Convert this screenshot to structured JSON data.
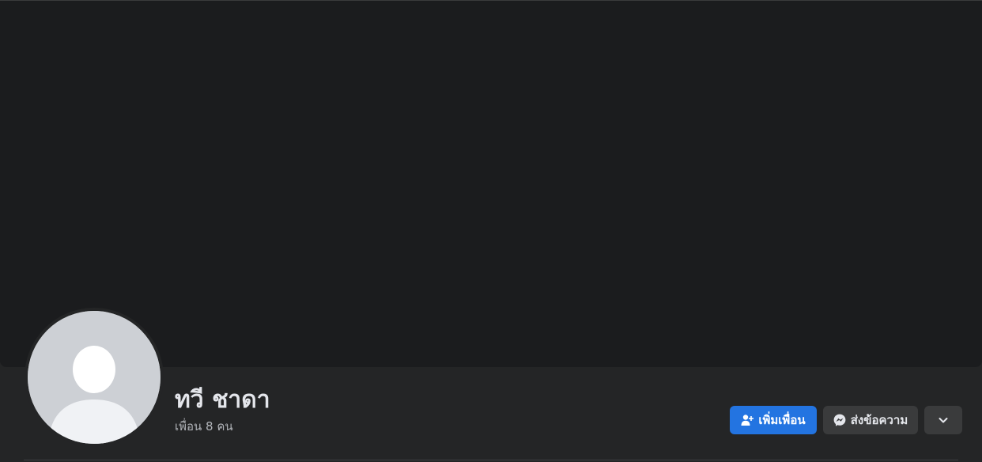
{
  "profile": {
    "name": "ทวี ชาดา",
    "friends_count_text": "เพื่อน 8 คน"
  },
  "actions": {
    "add_friend_label": "เพิ่มเพื่อน",
    "message_label": "ส่งข้อความ"
  },
  "icons": {
    "add_friend": "person-plus-icon",
    "message": "messenger-icon",
    "more": "chevron-down-icon",
    "avatar": "default-avatar-silhouette"
  },
  "colors": {
    "cover_bg": "#1b1c1e",
    "page_bg": "#242526",
    "primary_button": "#2374e1",
    "secondary_button": "#3a3b3c",
    "name_text": "#e4e6eb",
    "secondary_text": "#b0b3b8"
  }
}
